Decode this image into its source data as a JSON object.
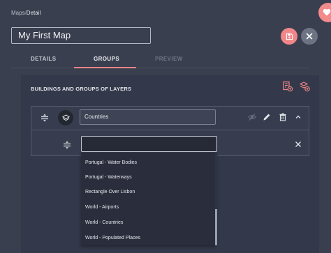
{
  "breadcrumb": {
    "root": "Maps",
    "separator": "/",
    "current": "Detail"
  },
  "map": {
    "title": "My First Map"
  },
  "tabs": [
    {
      "label": "DETAILS",
      "state": "normal"
    },
    {
      "label": "GROUPS",
      "state": "active"
    },
    {
      "label": "PREVIEW",
      "state": "disabled"
    }
  ],
  "section": {
    "title": "BUILDINGS AND GROUPS OF LAYERS"
  },
  "group": {
    "name": "Countries"
  },
  "layer_search": {
    "value": ""
  },
  "dropdown": {
    "options": [
      "Portugal - Water Bodies",
      "Portugal - Waterways",
      "Rectangle Over Lisbon",
      "World - Airports",
      "World - Countries",
      "World - Populated Places"
    ]
  },
  "colors": {
    "background": "#3a3f4f",
    "accent": "#f0868a",
    "panel": "#33384a",
    "dropdown": "#2a2e3c"
  },
  "icons": {
    "heart": "heart-icon",
    "save": "save-icon",
    "close": "close-icon",
    "add_building": "add-building-icon",
    "add_group": "add-layers-icon",
    "drag": "drag-handle-icon",
    "layers": "layers-icon",
    "visibility": "visibility-off-icon",
    "edit": "pencil-icon",
    "delete": "trash-icon",
    "collapse": "chevron-up-icon",
    "remove": "close-icon"
  }
}
